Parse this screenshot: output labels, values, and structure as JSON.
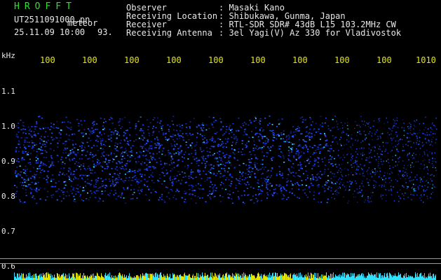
{
  "app": {
    "name": "HROFFT",
    "filename": "UT2511091000.pn",
    "datetime": "25.11.09 10:00",
    "mode_label": "meteor",
    "count": "93."
  },
  "station": {
    "observer_label": "Observer",
    "observer_value": ": Masaki Kano",
    "location_label": "Receiving Location",
    "location_value": ": Shibukawa, Gunma, Japan",
    "receiver_label": "Receiver",
    "receiver_value": ": RTL-SDR SDR# 43dB L15 103.2MHz CW",
    "antenna_label": "Receiving Antenna",
    "antenna_value": ": 3el Yagi(V) Az 330 for Vladivostok"
  },
  "axis": {
    "unit": "kHz",
    "y_ticks": [
      "1.1",
      "1.0",
      "0.9",
      "0.8",
      "0.7",
      "0.6"
    ],
    "time_ticks": [
      "100",
      "100",
      "100",
      "100",
      "100",
      "100",
      "100",
      "100",
      "100",
      "1010"
    ]
  },
  "colors": {
    "background": "#000000",
    "header_text": "#e8e8e8",
    "title_green": "#2fe02f",
    "time_yellow": "#e6e600",
    "signal_blue": "#1a3cff",
    "signal_cyan": "#30e0ff"
  }
}
